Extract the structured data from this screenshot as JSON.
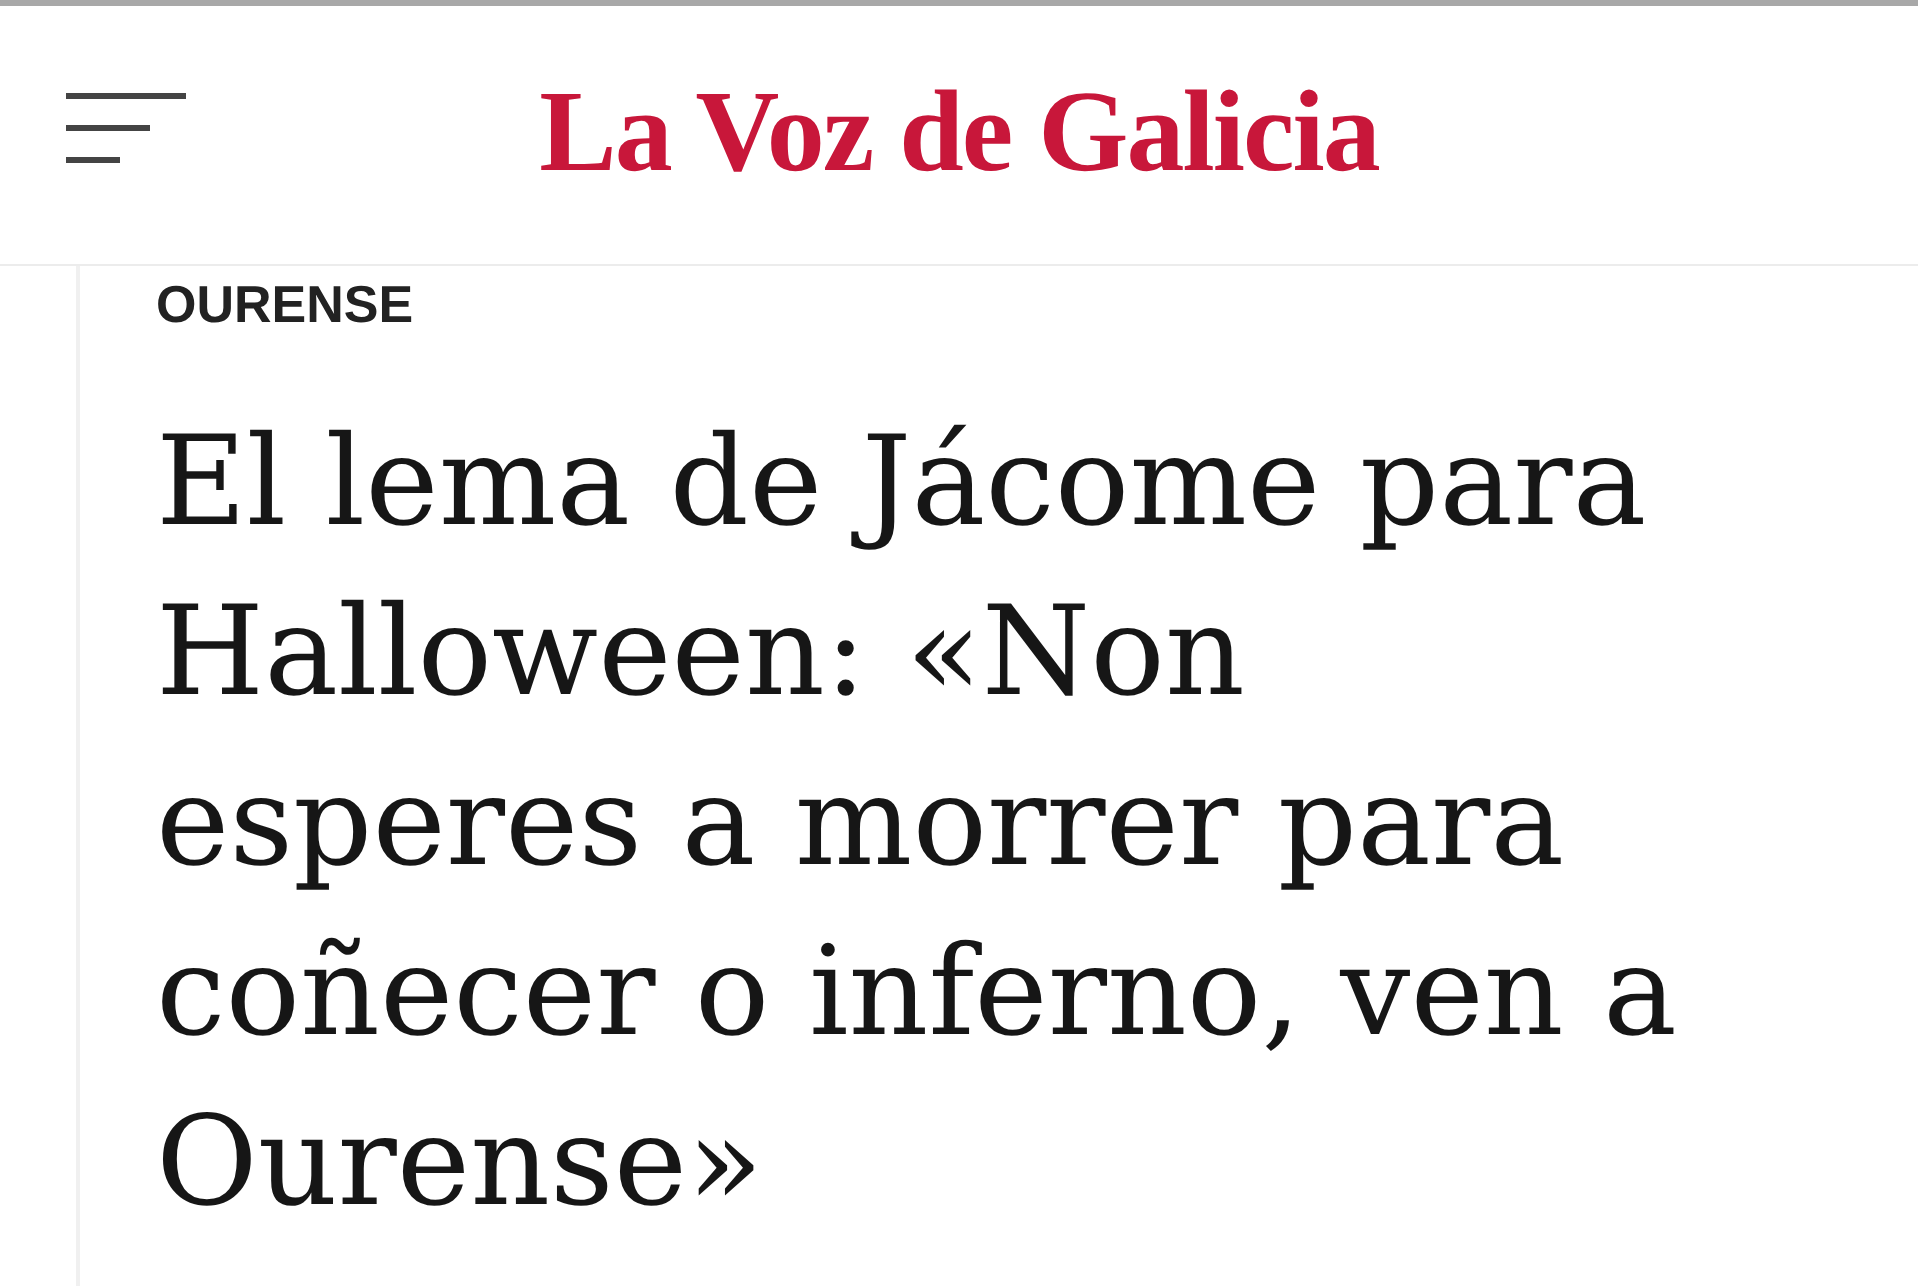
{
  "header": {
    "logo": "La Voz de Galicia"
  },
  "article": {
    "section": "OURENSE",
    "headline": "El lema de Jácome para Halloween: «Non esperes a morrer para coñecer o inferno, ven a Ourense»"
  }
}
